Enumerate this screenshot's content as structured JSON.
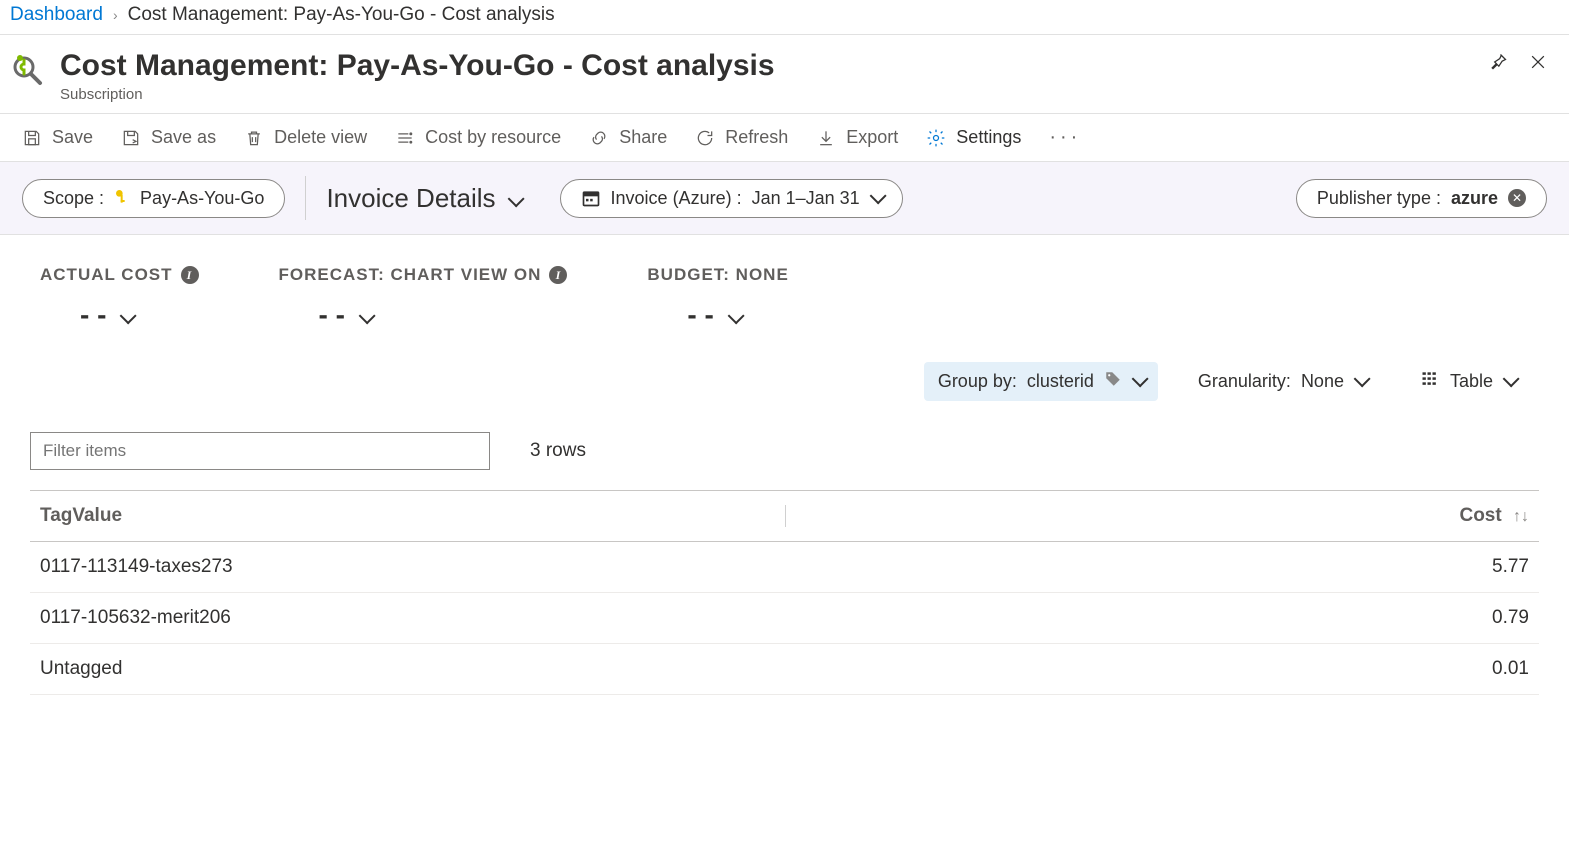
{
  "breadcrumb": {
    "root": "Dashboard",
    "current": "Cost Management: Pay-As-You-Go - Cost analysis"
  },
  "header": {
    "title": "Cost Management: Pay-As-You-Go - Cost analysis",
    "subtitle": "Subscription"
  },
  "toolbar": {
    "save": "Save",
    "save_as": "Save as",
    "delete_view": "Delete view",
    "cost_by_resource": "Cost by resource",
    "share": "Share",
    "refresh": "Refresh",
    "export": "Export",
    "settings": "Settings"
  },
  "filterbar": {
    "scope_label": "Scope :",
    "scope_value": "Pay-As-You-Go",
    "view_name": "Invoice Details",
    "date_label": "Invoice (Azure) :",
    "date_value": "Jan 1–Jan 31",
    "publisher_label": "Publisher type :",
    "publisher_value": "azure"
  },
  "kpi": {
    "actual_cost_label": "ACTUAL COST",
    "actual_cost_value": "- -",
    "forecast_label": "FORECAST: CHART VIEW ON",
    "forecast_value": "- -",
    "budget_label": "BUDGET: NONE",
    "budget_value": "- -"
  },
  "viewcontrols": {
    "groupby_label": "Group by:",
    "groupby_value": "clusterid",
    "granularity_label": "Granularity:",
    "granularity_value": "None",
    "viewtype": "Table"
  },
  "table": {
    "filter_placeholder": "Filter items",
    "row_count_text": "3 rows",
    "col_tag": "TagValue",
    "col_cost": "Cost",
    "rows": [
      {
        "tag": "0117-113149-taxes273",
        "cost": "5.77"
      },
      {
        "tag": "0117-105632-merit206",
        "cost": "0.79"
      },
      {
        "tag": "Untagged",
        "cost": "0.01"
      }
    ]
  }
}
